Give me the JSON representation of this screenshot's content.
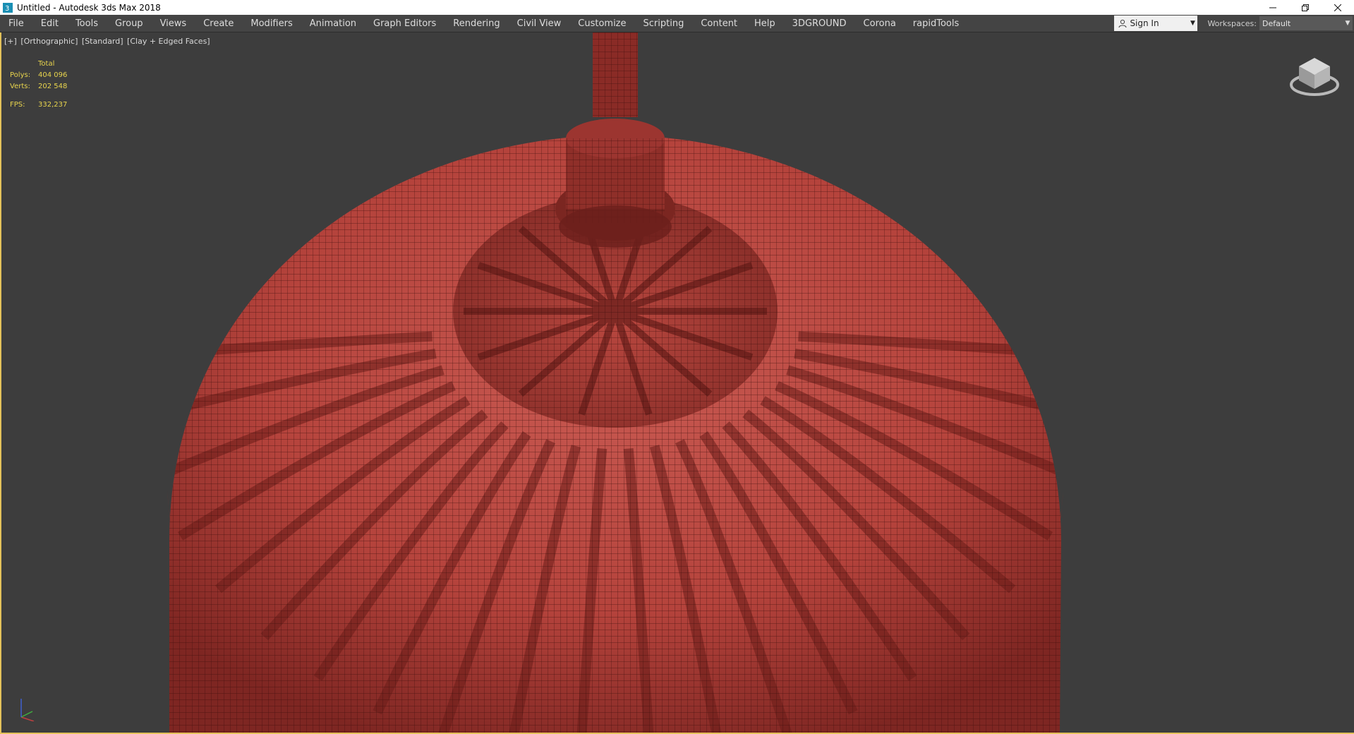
{
  "window": {
    "title": "Untitled - Autodesk 3ds Max 2018",
    "controls": [
      "minimize",
      "restore",
      "close"
    ]
  },
  "menubar": {
    "items": [
      "File",
      "Edit",
      "Tools",
      "Group",
      "Views",
      "Create",
      "Modifiers",
      "Animation",
      "Graph Editors",
      "Rendering",
      "Civil View",
      "Customize",
      "Scripting",
      "Content",
      "Help",
      "3DGROUND",
      "Corona",
      "rapidTools"
    ],
    "signin_label": "Sign In",
    "workspaces_label": "Workspaces:",
    "workspace_value": "Default"
  },
  "viewport": {
    "labels": [
      "[+]",
      "[Orthographic]",
      "[Standard]",
      "[Clay + Edged Faces]"
    ],
    "stats": {
      "header": "Total",
      "polys_label": "Polys:",
      "polys_value": "404 096",
      "verts_label": "Verts:",
      "verts_value": "202 548",
      "fps_label": "FPS:",
      "fps_value": "332,237"
    },
    "model_color": "#b5433c",
    "background_color": "#3d3d3d",
    "active_border_color": "#e3c15a"
  }
}
